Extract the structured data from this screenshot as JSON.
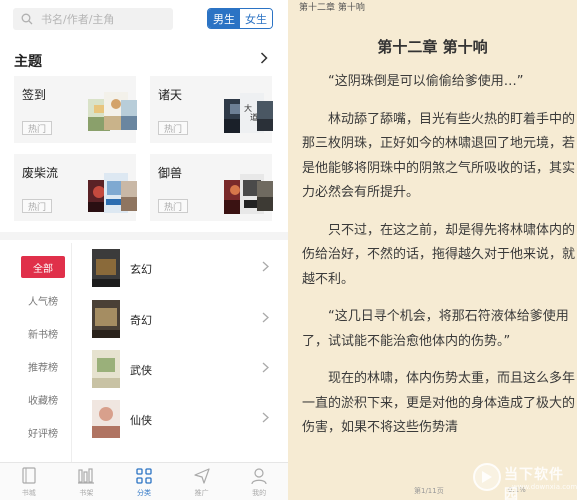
{
  "left": {
    "search": {
      "placeholder": "书名/作者/主角"
    },
    "gender": {
      "male": "男生",
      "female": "女生"
    },
    "section": {
      "title": "主题"
    },
    "themes": [
      {
        "name": "签到",
        "tag": "热门"
      },
      {
        "name": "诸天",
        "tag": "热门"
      },
      {
        "name": "废柴流",
        "tag": "热门"
      },
      {
        "name": "御兽",
        "tag": "热门"
      }
    ],
    "categories": [
      "全部",
      "人气榜",
      "新书榜",
      "推荐榜",
      "收藏榜",
      "好评榜"
    ],
    "genres": [
      "玄幻",
      "奇幻",
      "武侠",
      "仙侠"
    ],
    "nav": [
      {
        "label": "书城",
        "icon": "book-icon"
      },
      {
        "label": "书架",
        "icon": "bookshelf-icon"
      },
      {
        "label": "分类",
        "icon": "category-grid-icon"
      },
      {
        "label": "推广",
        "icon": "send-icon"
      },
      {
        "label": "我的",
        "icon": "user-icon"
      }
    ],
    "colors": {
      "accent": "#2b73c4",
      "active_category": "#e0304a"
    }
  },
  "right": {
    "header": "第十二章 第十响",
    "title": "第十二章 第十响",
    "paragraphs": [
      "“这阴珠倒是可以偷偷给爹使用…”",
      "林动舔了舔嘴，目光有些火热的盯着手中的那三枚阴珠，正好如今的林啸退回了地元境，若是他能够将阴珠中的阴煞之气所吸收的话，其实力必然会有所提升。",
      "只不过，在这之前，却是得先将林啸体内的伤给治好，不然的话，拖得越久对于他来说，就越不利。",
      "“这几日寻个机会，将那石符液体给爹使用了，试试能不能治愈他体内的伤势。”",
      "现在的林啸，体内伤势太重，而且这么多年一直的淤积下来，更是对他的身体造成了极大的伤害，如果不将这些伤势清"
    ],
    "footer": {
      "page": "第1/11页",
      "percent": "0.1%"
    },
    "watermark": {
      "title": "当下软件园",
      "sub": "www.downxia.com"
    },
    "colors": {
      "background": "#f6ebd3"
    }
  }
}
